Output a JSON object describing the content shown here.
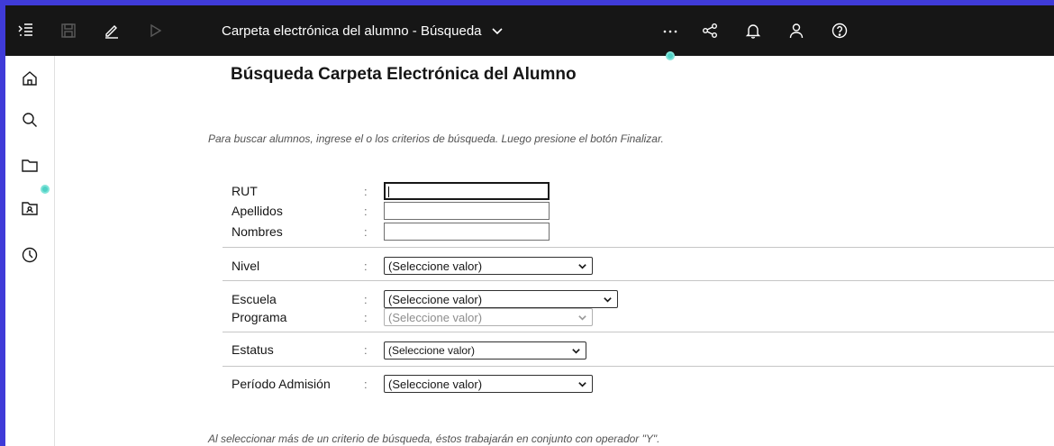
{
  "topbar": {
    "title": "Carpeta electrónica del alumno - Búsqueda"
  },
  "icons": {
    "menu": "menu-icon",
    "save": "save-icon",
    "edit": "edit-icon",
    "run": "play-icon",
    "more": "ellipsis-icon",
    "share": "share-icon",
    "notifications": "bell-icon",
    "user": "user-icon",
    "help": "help-icon",
    "home": "home-icon",
    "search": "search-icon",
    "folder": "folder-icon",
    "student_folder": "contact-folder-icon",
    "recent": "clock-icon"
  },
  "colors": {
    "topbar_bg": "#161616",
    "frame_accent": "#3f3bd8",
    "indicator": "#4fd1c5"
  },
  "page": {
    "title": "Búsqueda Carpeta Electrónica del Alumno",
    "instructions": "Para buscar alumnos, ingrese el o los criterios de búsqueda. Luego presione el botón Finalizar.",
    "footer_note": "Al seleccionar más de un criterio de búsqueda, éstos trabajarán en conjunto con operador \"Y\"."
  },
  "form": {
    "colon": ":",
    "rut_label": "RUT",
    "rut_value": "",
    "apellidos_label": "Apellidos",
    "apellidos_value": "",
    "nombres_label": "Nombres",
    "nombres_value": "",
    "nivel_label": "Nivel",
    "nivel_value": "(Seleccione valor)",
    "escuela_label": "Escuela",
    "escuela_value": "(Seleccione valor)",
    "programa_label": "Programa",
    "programa_value": "(Seleccione valor)",
    "estatus_label": "Estatus",
    "estatus_value": "(Seleccione valor)",
    "periodo_label": "Período Admisión",
    "periodo_value": "(Seleccione valor)"
  }
}
